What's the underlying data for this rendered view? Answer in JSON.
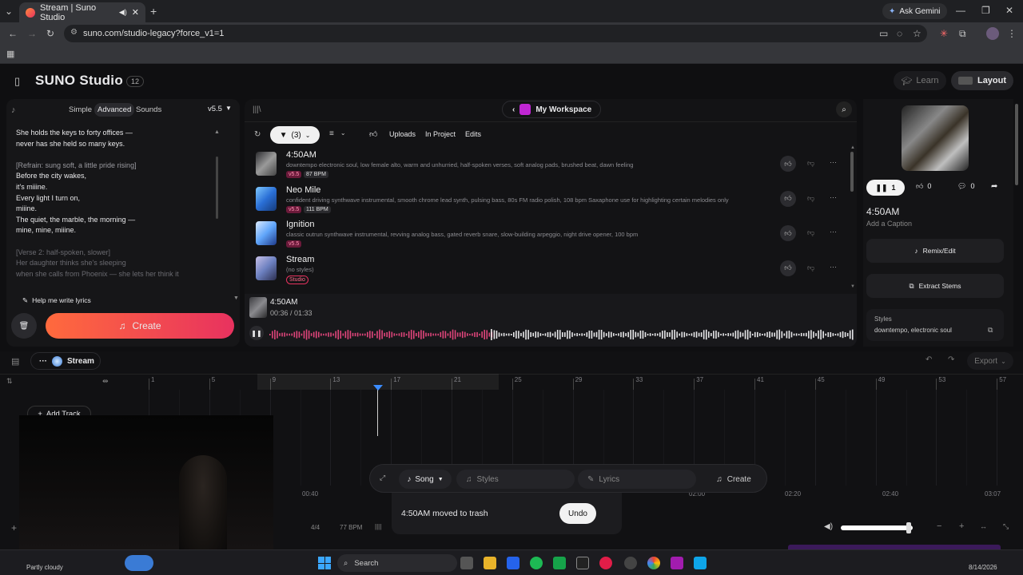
{
  "browser": {
    "tab_title": "Stream | Suno Studio",
    "url": "suno.com/studio-legacy?force_v1=1",
    "ask_label": "Ask Gemini"
  },
  "header": {
    "logo": "SUNO Studio",
    "count_badge": "12",
    "learn": "Learn",
    "layout": "Layout"
  },
  "left": {
    "tabs": [
      "Simple",
      "Advanced",
      "Sounds"
    ],
    "version": "v5.5",
    "lyrics": [
      "She holds the keys to forty offices —",
      "never has she held so many keys.",
      "",
      "[Refrain: sung soft, a little pride rising]",
      "Before the city wakes,",
      "it's miiine.",
      "Every light I turn on,",
      "miiine.",
      "The quiet, the marble, the morning —",
      "mine, mine, miiine.",
      "",
      "[Verse 2: half-spoken, slower]",
      "Her daughter thinks she's sleeping",
      "when she calls from Phoenix — she lets her think it"
    ],
    "help": "Help me write lyrics",
    "create": "Create"
  },
  "center": {
    "workspace": "My Workspace",
    "filter": "(3)",
    "chips": [
      "Uploads",
      "In Project",
      "Edits"
    ],
    "songs": [
      {
        "title": "4:50AM",
        "desc": "downtempo electronic soul, low female alto, warm and unhurried, half-spoken verses, soft analog pads, brushed beat, dawn feeling",
        "badge1": "v5.5",
        "badge2": "87 BPM"
      },
      {
        "title": "Neo Mile",
        "desc": "confident driving synthwave instrumental, smooth chrome lead synth, pulsing bass, 80s FM radio polish, 108 bpm Saxaphone use for highlighting certain melodies only",
        "badge1": "v5.5",
        "badge2": "111 BPM"
      },
      {
        "title": "Ignition",
        "desc": "classic outrun synthwave instrumental, revving analog bass, gated reverb snare, slow-building arpeggio, night drive opener, 100 bpm",
        "badge1": "v5.5",
        "badge2": ""
      },
      {
        "title": "Stream",
        "desc": "(no styles)",
        "badge1": "Studio",
        "badge2": ""
      }
    ],
    "player_title": "4:50AM",
    "player_time": "00:36 / 01:33",
    "playback_fraction": 0.38
  },
  "right": {
    "likes": "1",
    "thumbs": "0",
    "comments": "0",
    "title": "4:50AM",
    "caption": "Add a Caption",
    "remix": "Remix/Edit",
    "stems": "Extract Stems",
    "styles_label": "Styles",
    "styles_value": "downtempo, electronic soul"
  },
  "timeline": {
    "project": "Stream",
    "export": "Export",
    "add_track": "Add Track",
    "bars": [
      "1",
      "5",
      "9",
      "13",
      "17",
      "21",
      "25",
      "29",
      "33",
      "37",
      "41",
      "45",
      "49",
      "53",
      "57"
    ],
    "times": [
      "00:40",
      "02:00",
      "02:20",
      "02:40",
      "03:07"
    ],
    "signature": "4/4",
    "bpm": "77 BPM"
  },
  "composer": {
    "mode": "Song",
    "styles": "Styles",
    "lyrics": "Lyrics",
    "create": "Create"
  },
  "toast": {
    "message": "4:50AM moved to trash",
    "undo": "Undo"
  },
  "taskbar": {
    "weather": "Partly cloudy",
    "search": "Search",
    "date": "8/14/2026"
  },
  "colors": {
    "accent": "#ff4d6d",
    "create_gradient_start": "#ff6a3d",
    "create_gradient_end": "#e8325f",
    "waveform_played": "#e0457b",
    "playhead": "#3b8cff"
  }
}
